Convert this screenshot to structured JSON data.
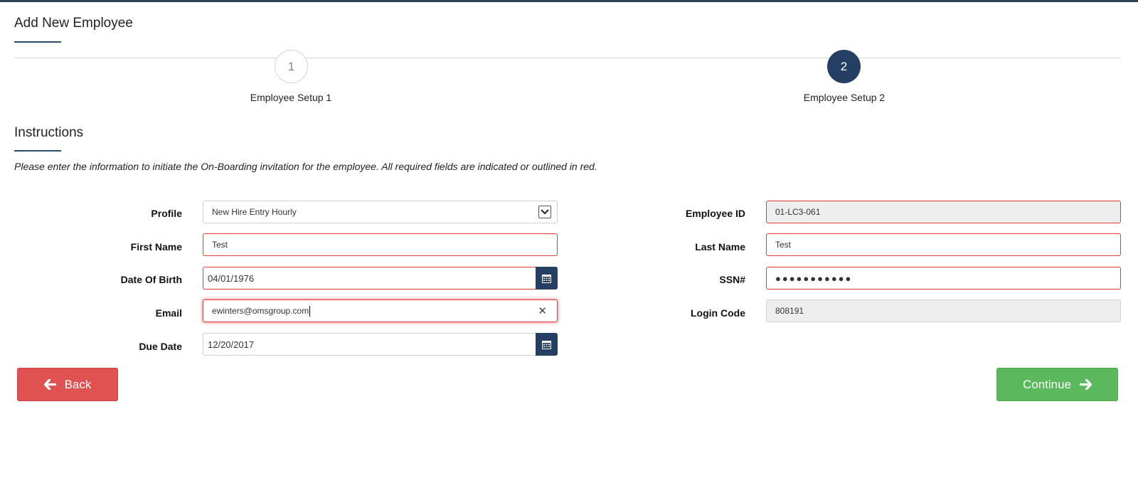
{
  "page": {
    "title": "Add New Employee",
    "wizard": {
      "steps": [
        {
          "number": "1",
          "label": "Employee Setup 1",
          "active": false
        },
        {
          "number": "2",
          "label": "Employee Setup 2",
          "active": true
        }
      ]
    },
    "instructions": {
      "title": "Instructions",
      "text": "Please enter the information to initiate the On-Boarding invitation for the employee.  All required fields are indicated or outlined in red."
    }
  },
  "form": {
    "profile": {
      "label": "Profile",
      "value": "New Hire Entry Hourly"
    },
    "first_name": {
      "label": "First Name",
      "value": "Test"
    },
    "dob": {
      "label": "Date Of Birth",
      "value": "04/01/1976"
    },
    "email": {
      "label": "Email",
      "value": "ewinters@omsgroup.com"
    },
    "due_date": {
      "label": "Due Date",
      "value": "12/20/2017"
    },
    "employee_id": {
      "label": "Employee ID",
      "value": "01-LC3-061"
    },
    "last_name": {
      "label": "Last Name",
      "value": "Test"
    },
    "ssn": {
      "label": "SSN#",
      "value": "●●●●●●●●●●●"
    },
    "login_code": {
      "label": "Login Code",
      "value": "808191"
    }
  },
  "actions": {
    "back_label": "Back",
    "continue_label": "Continue"
  },
  "colors": {
    "primary_navy": "#243f63",
    "required_red": "#e23a3a",
    "back_red": "#e05252",
    "continue_green": "#5cb85c"
  }
}
